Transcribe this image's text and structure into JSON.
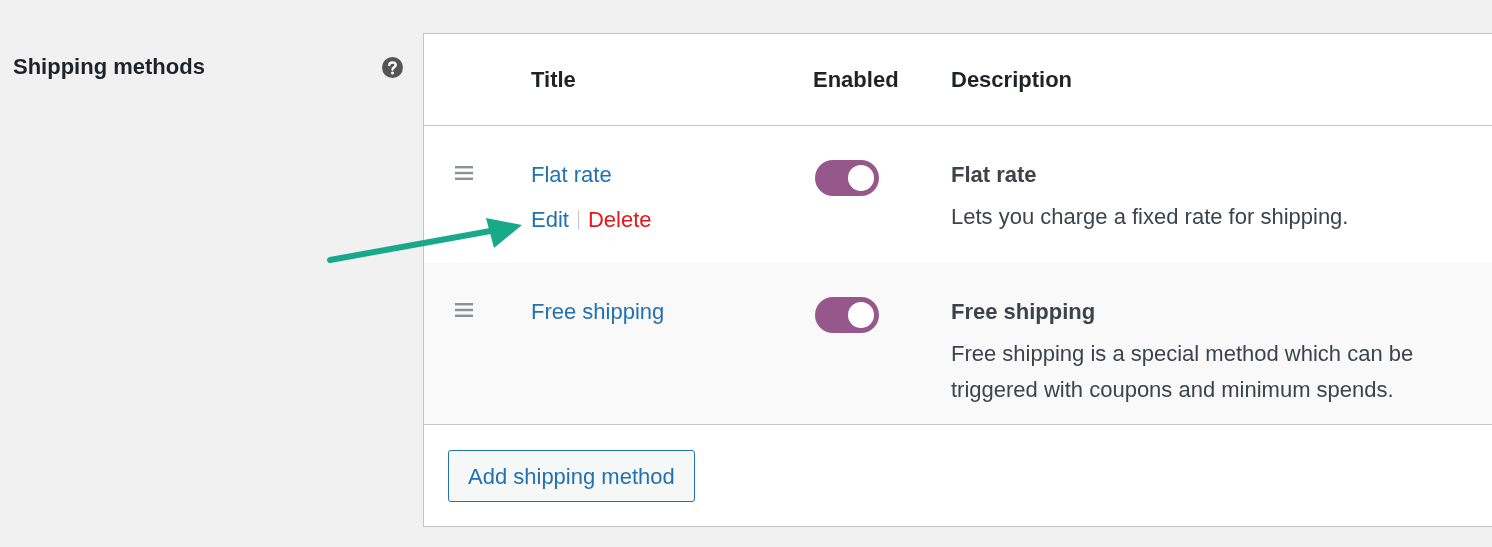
{
  "section": {
    "label": "Shipping methods"
  },
  "table": {
    "columns": [
      "Title",
      "Enabled",
      "Description"
    ],
    "rows": [
      {
        "title": "Flat rate",
        "actions": [
          "Edit",
          "Delete"
        ],
        "enabled": true,
        "description_title": "Flat rate",
        "description": "Lets you charge a fixed rate for shipping."
      },
      {
        "title": "Free shipping",
        "enabled": true,
        "description_title": "Free shipping",
        "description": "Free shipping is a special method which can be triggered with coupons and minimum spends."
      }
    ]
  },
  "add_button": "Add shipping method"
}
